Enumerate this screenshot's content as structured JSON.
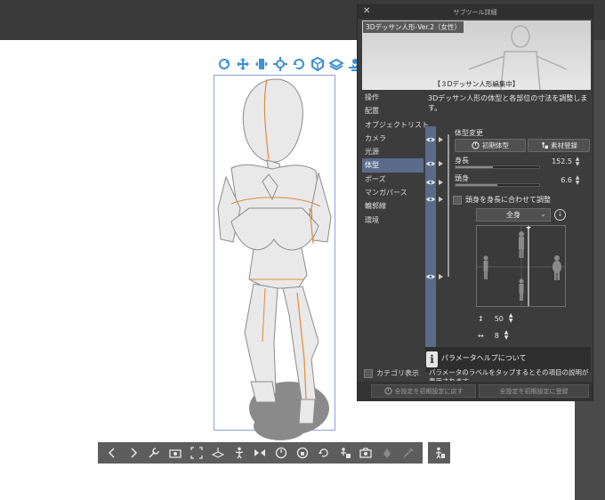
{
  "panel": {
    "title": "サブツール詳細",
    "preview_name": "3Dデッサン人形-Ver.2（女性）",
    "editing_label": "【３Dデッサン人形編集中】",
    "description": "3Dデッサン人形の体型と各部位の寸法を調整します。",
    "categories": [
      {
        "label": "操作",
        "selected": false
      },
      {
        "label": "配置",
        "selected": false
      },
      {
        "label": "オブジェクトリスト",
        "selected": false
      },
      {
        "label": "カメラ",
        "selected": false
      },
      {
        "label": "光源",
        "selected": false
      },
      {
        "label": "体型",
        "selected": true
      },
      {
        "label": "ポーズ",
        "selected": false
      },
      {
        "label": "マンガパース",
        "selected": false
      },
      {
        "label": "輪郭線",
        "selected": false
      },
      {
        "label": "環境",
        "selected": false
      }
    ],
    "category_show_label": "カテゴリ表示",
    "section_title": "体型変更",
    "initial_body_label": "初期体型",
    "register_material_label": "素材登録",
    "height_label": "身長",
    "height_value": "152.5",
    "height_fraction": 0.45,
    "head_label": "頭身",
    "head_value": "6.6",
    "head_fraction": 0.5,
    "adjust_label": "頭身を身長に合わせて調整",
    "body_part_selected": "全身",
    "scale_value": "50",
    "spacing_value": "8",
    "help_title": "パラメータヘルプについて",
    "help_text": "パラメータのラベルをタップするとその項目の説明が表示されます。",
    "reset_all_label": "全設定を初期設定に戻す",
    "register_all_label": "全設定を初期設定に登録"
  },
  "object_toolbar_icons": [
    "camera-rotate-icon",
    "camera-pan-icon",
    "camera-zoom-icon",
    "move-icon",
    "rotate-icon",
    "scale-icon",
    "plane-move-icon",
    "drop-to-ground-icon"
  ],
  "bottom_toolbar_icons": [
    "prev-icon",
    "next-icon",
    "wrench-icon",
    "camera-icon",
    "fit-icon",
    "ground-icon",
    "pose-icon",
    "flip-icon",
    "reset-icon",
    "lock-icon",
    "rotate-lock-icon",
    "settings-icon",
    "capture-icon",
    "hand-icon",
    "foot-icon"
  ],
  "colors": {
    "panel_bg": "#3c3c3c",
    "selected_category": "#5b6b8c",
    "toolbar_bg": "#5d5d5d",
    "accent_icon": "#3d8fd6",
    "guide_line": "#e08a3c"
  }
}
